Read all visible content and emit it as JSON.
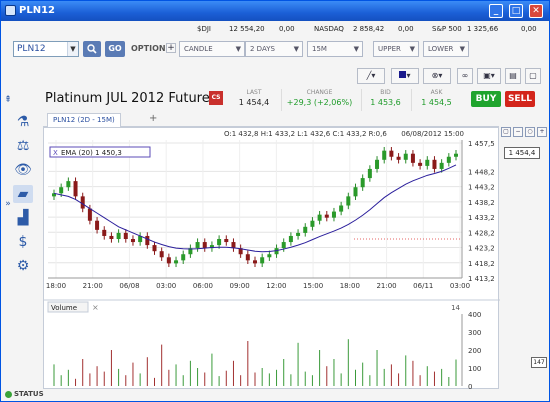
{
  "window": {
    "title": "PLN12"
  },
  "ticker": [
    {
      "name": "$DJI",
      "value": "12 554,20",
      "change": "0,00"
    },
    {
      "name": "NASDAQ",
      "value": "2 858,42",
      "change": "0,00"
    },
    {
      "name": "S&P 500",
      "value": "1 325,66",
      "change": "0,00"
    }
  ],
  "toolbar": {
    "symbol": "PLN12",
    "go": "GO",
    "option": "OPTION",
    "chart_type": "CANDLE",
    "period": "2 DAYS",
    "interval": "15M",
    "upper": "UPPER",
    "lower": "LOWER"
  },
  "instrument": {
    "name": "Platinum JUL 2012 Future",
    "cs": "CS",
    "last_label": "LAST",
    "last": "1 454,4",
    "change_label": "CHANGE",
    "change": "+29,3 (+2,06%)",
    "bid_label": "BID",
    "bid": "1 453,6",
    "ask_label": "ASK",
    "ask": "1 454,5",
    "buy": "BUY",
    "sell": "SELL"
  },
  "tab": {
    "label": "PLN12 (2D - 15M)",
    "add": "+"
  },
  "chart": {
    "ohlc": "O:1 432,8 H:1 433,2 L:1 432,6 C:1 433,2 R:0,6",
    "datetime": "06/08/2012 15:00",
    "ema_label": "EMA (20) 1 450,3",
    "price_label": "1 454,4",
    "volume_label": "Volume",
    "volume_value": "147",
    "volume_panel_number": "14",
    "price_ticks": [
      "1 457,5",
      "1 448,2",
      "1 443,2",
      "1 438,2",
      "1 433,2",
      "1 428,2",
      "1 423,2",
      "1 418,2",
      "1 413,2"
    ],
    "volume_ticks": [
      "400",
      "300",
      "200",
      "100",
      "0"
    ],
    "time_ticks": [
      "18:00",
      "21:00",
      "06/08",
      "03:00",
      "06:00",
      "09:00",
      "12:00",
      "15:00",
      "18:00",
      "21:00",
      "06/11",
      "03:00"
    ]
  },
  "chart_data": {
    "type": "candlestick",
    "title": "PLN12 (2D - 15M)",
    "ylim": [
      1413.2,
      1458.5
    ],
    "volume_ylim": [
      0,
      400
    ],
    "close_path": [
      1441,
      1443,
      1445,
      1440,
      1436,
      1432,
      1429,
      1427,
      1426,
      1428,
      1426,
      1425,
      1427,
      1424,
      1422,
      1420,
      1418,
      1419,
      1421,
      1423,
      1425,
      1423,
      1424,
      1426,
      1425,
      1423,
      1421,
      1419,
      1418,
      1420,
      1421,
      1423,
      1425,
      1427,
      1428,
      1430,
      1432,
      1434,
      1433,
      1435,
      1437,
      1440,
      1443,
      1446,
      1449,
      1452,
      1455,
      1453,
      1452,
      1454,
      1451,
      1450,
      1452,
      1449,
      1451,
      1453,
      1454
    ],
    "ema_path": [
      1441,
      1440.5,
      1440,
      1439,
      1437.5,
      1436,
      1434.5,
      1433,
      1431.5,
      1430,
      1429,
      1428,
      1427,
      1426,
      1425,
      1424.2,
      1423.5,
      1423,
      1422.8,
      1422.7,
      1422.8,
      1423,
      1423.2,
      1423.3,
      1423.3,
      1423.1,
      1422.8,
      1422.4,
      1422,
      1421.8,
      1421.9,
      1422.2,
      1422.7,
      1423.3,
      1424,
      1424.8,
      1425.8,
      1426.8,
      1427.7,
      1428.6,
      1429.6,
      1430.8,
      1432.2,
      1433.8,
      1435.6,
      1437.6,
      1439.6,
      1441.2,
      1442.6,
      1444,
      1445.1,
      1446,
      1446.9,
      1447.5,
      1448.2,
      1449.2,
      1450.3
    ],
    "volumes": [
      120,
      60,
      90,
      40,
      150,
      70,
      110,
      80,
      200,
      95,
      60,
      130,
      70,
      160,
      45,
      230,
      90,
      120,
      60,
      140,
      100,
      75,
      180,
      55,
      85,
      140,
      60,
      250,
      75,
      100,
      70,
      90,
      150,
      65,
      240,
      80,
      60,
      200,
      110,
      150,
      70,
      260,
      90,
      130,
      60,
      200,
      95,
      120,
      70,
      170,
      140,
      60,
      110,
      80,
      95,
      50,
      147
    ]
  }
}
